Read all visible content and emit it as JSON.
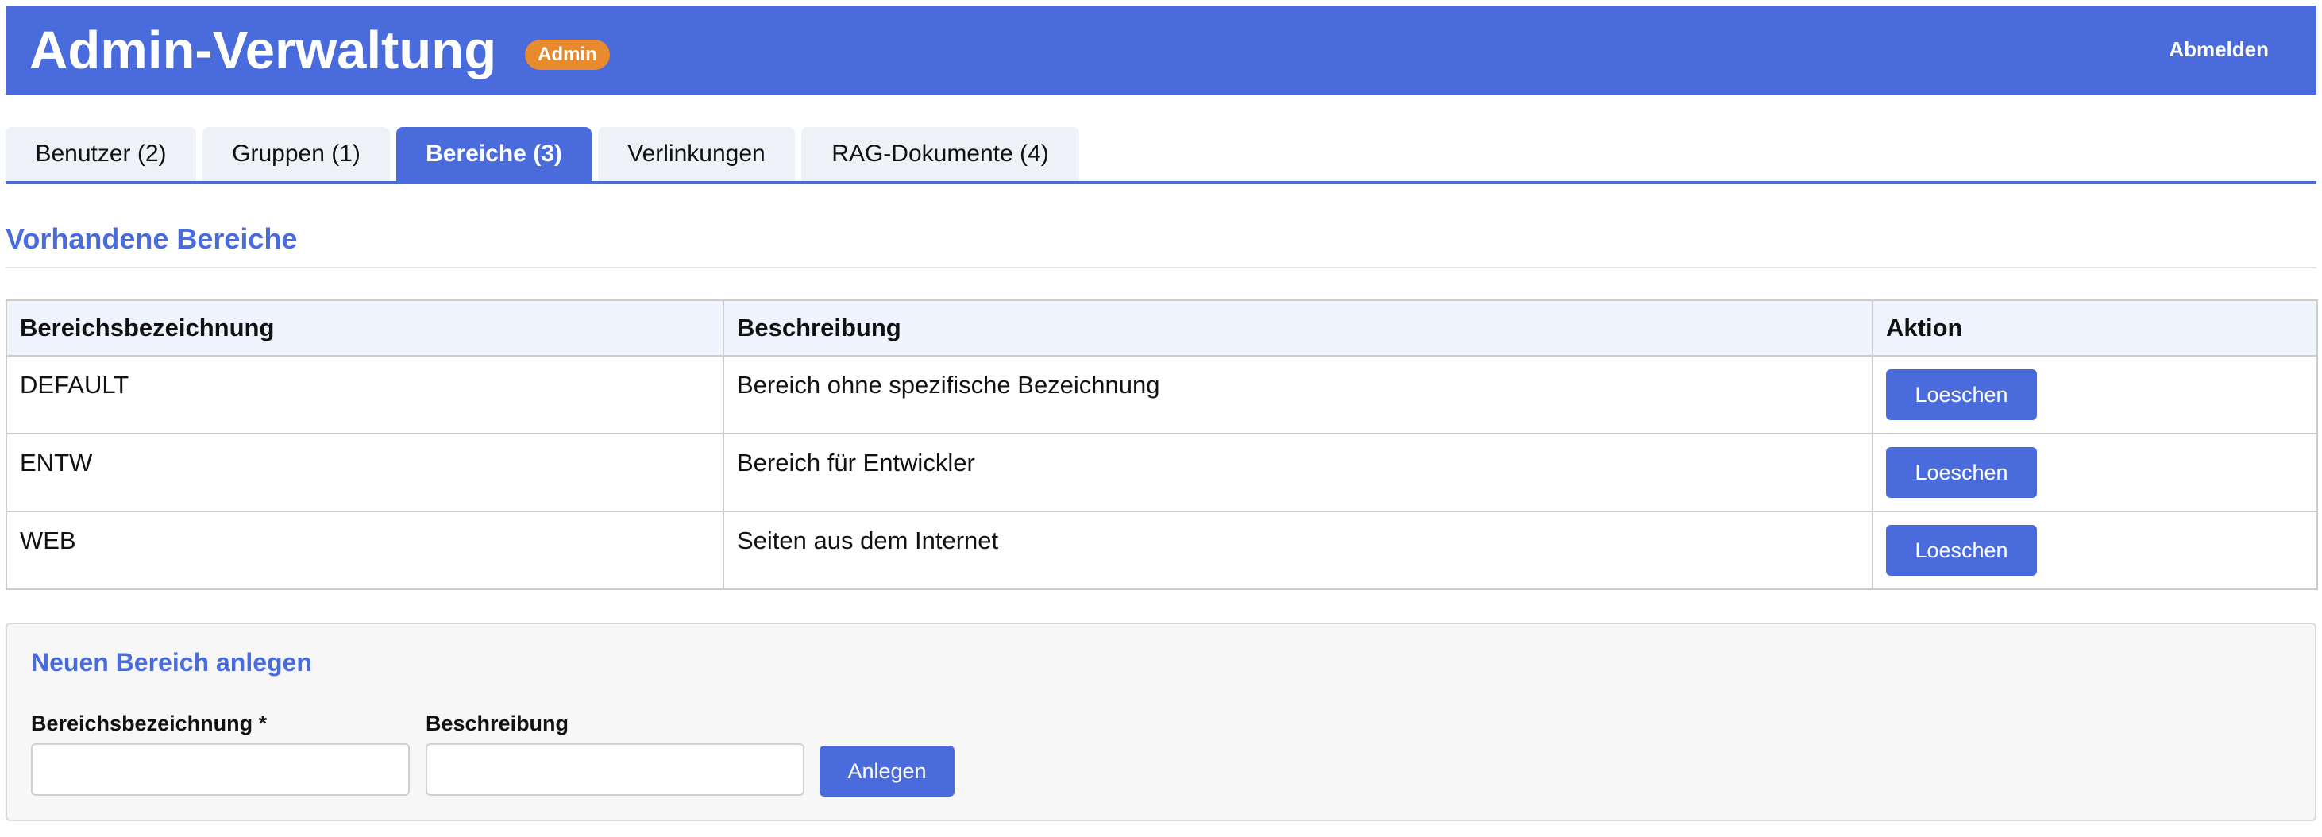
{
  "header": {
    "title": "Admin-Verwaltung",
    "role_badge": "Admin",
    "logout_label": "Abmelden"
  },
  "tabs": [
    {
      "label": "Benutzer (2)",
      "active": false
    },
    {
      "label": "Gruppen (1)",
      "active": false
    },
    {
      "label": "Bereiche (3)",
      "active": true
    },
    {
      "label": "Verlinkungen",
      "active": false
    },
    {
      "label": "RAG-Dokumente (4)",
      "active": false
    }
  ],
  "section": {
    "title": "Vorhandene Bereiche"
  },
  "table": {
    "columns": [
      "Bereichsbezeichnung",
      "Beschreibung",
      "Aktion"
    ],
    "rows": [
      {
        "name": "DEFAULT",
        "description": "Bereich ohne spezifische Bezeichnung",
        "action": "Loeschen"
      },
      {
        "name": "ENTW",
        "description": "Bereich für Entwickler",
        "action": "Loeschen"
      },
      {
        "name": "WEB",
        "description": "Seiten aus dem Internet",
        "action": "Loeschen"
      }
    ]
  },
  "create_form": {
    "title": "Neuen Bereich anlegen",
    "name_label": "Bereichsbezeichnung *",
    "name_value": "",
    "description_label": "Beschreibung",
    "description_value": "",
    "submit_label": "Anlegen"
  },
  "colors": {
    "primary": "#4a6bdc",
    "badge": "#e88a2e",
    "table_header_bg": "#eff3fd",
    "tab_bg": "#eef1f6",
    "panel_bg": "#f7f7f7"
  }
}
